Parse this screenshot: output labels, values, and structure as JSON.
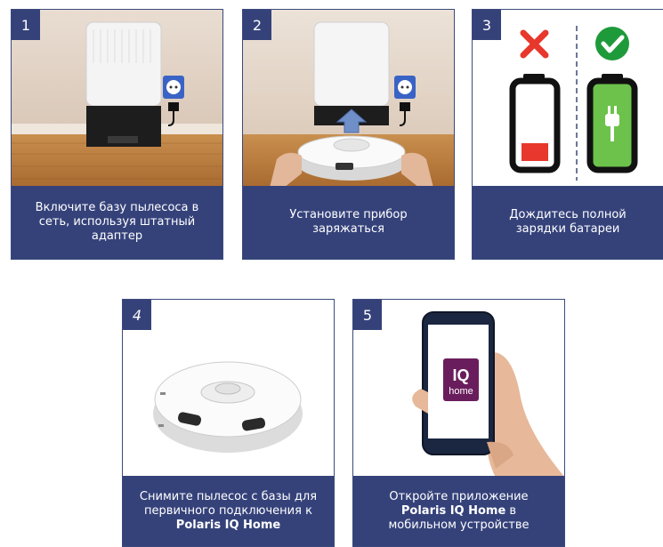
{
  "steps": [
    {
      "number": "1",
      "caption": "Включите базу пылесоса в сеть, используя штатный адаптер"
    },
    {
      "number": "2",
      "caption": "Установите прибор заряжаться"
    },
    {
      "number": "3",
      "caption": "Дождитесь полной зарядки батареи"
    },
    {
      "number": "4",
      "caption_pre": "Снимите пылесос с базы для первичного подключения к ",
      "caption_bold": "Polaris IQ Home"
    },
    {
      "number": "5",
      "caption_pre": "Откройте приложение ",
      "caption_bold": "Polaris IQ Home",
      "caption_post": " в мобильном устройстве"
    }
  ],
  "app_icon": {
    "line1": "IQ",
    "line2": "home"
  },
  "colors": {
    "panel": "#35427a",
    "fail": "#e8372c",
    "success": "#1f9a3a",
    "battery_empty": "#e8372c",
    "battery_full": "#6cc24a"
  }
}
